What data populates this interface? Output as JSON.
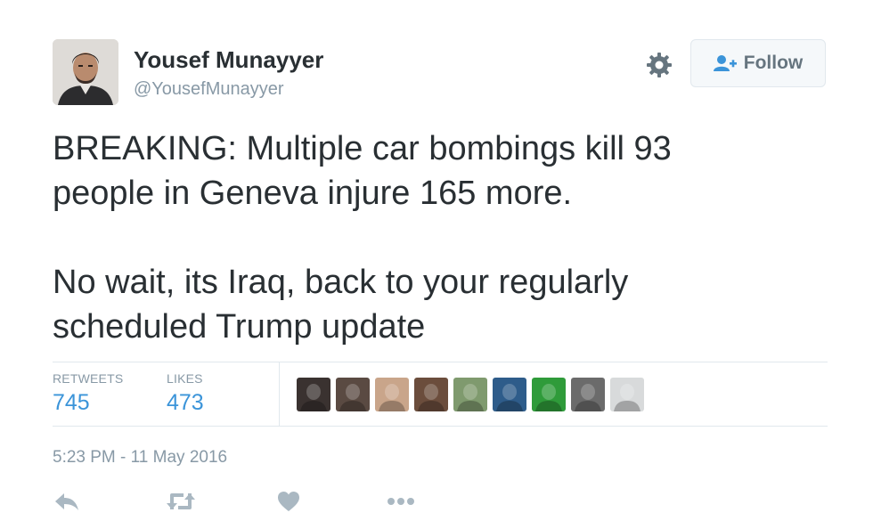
{
  "user": {
    "name": "Yousef Munayyer",
    "handle": "@YousefMunayyer"
  },
  "header": {
    "follow_label": "Follow",
    "icons": [
      "gear-icon",
      "follow-user-icon"
    ]
  },
  "tweet": {
    "text": "BREAKING: Multiple car bombings kill 93\npeople in Geneva injure 165 more.\n\nNo wait, its Iraq, back to your regularly\nscheduled Trump update"
  },
  "stats": {
    "retweets_label": "RETWEETS",
    "retweets_count": "745",
    "likes_label": "LIKES",
    "likes_count": "473"
  },
  "likers": [
    {
      "avatar_color": "#3a3230"
    },
    {
      "avatar_color": "#5a4a42"
    },
    {
      "avatar_color": "#c9a58a"
    },
    {
      "avatar_color": "#6b4d3c"
    },
    {
      "avatar_color": "#7f9a6e"
    },
    {
      "avatar_color": "#2e5c8a"
    },
    {
      "avatar_color": "#2f9b3a"
    },
    {
      "avatar_color": "#6b6b6b"
    },
    {
      "avatar_color": "#d8dadb"
    }
  ],
  "timestamp": "5:23 PM - 11 May 2016",
  "actions": [
    "reply-icon",
    "retweet-icon",
    "like-icon",
    "more-icon"
  ],
  "colors": {
    "text": "#292f33",
    "muted": "#8899a6",
    "link": "#3b94d9",
    "border": "#e1e8ed",
    "icon": "#aab8c2"
  }
}
